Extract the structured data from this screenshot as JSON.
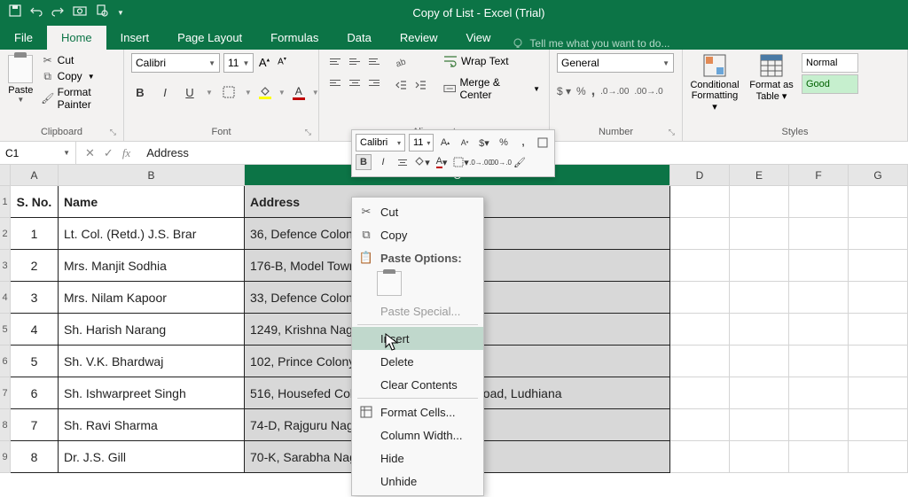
{
  "app": {
    "title": "Copy of List - Excel (Trial)"
  },
  "tabs": {
    "file": "File",
    "home": "Home",
    "insert": "Insert",
    "page_layout": "Page Layout",
    "formulas": "Formulas",
    "data": "Data",
    "review": "Review",
    "view": "View",
    "tellme": "Tell me what you want to do..."
  },
  "ribbon": {
    "clipboard": {
      "paste": "Paste",
      "cut": "Cut",
      "copy": "Copy",
      "format_painter": "Format Painter",
      "label": "Clipboard"
    },
    "font": {
      "name": "Calibri",
      "size": "11",
      "label": "Font"
    },
    "alignment": {
      "wrap": "Wrap Text",
      "merge": "Merge & Center",
      "label": "Alignment"
    },
    "number": {
      "format": "General",
      "label": "Number"
    },
    "styles": {
      "conditional": "Conditional Formatting",
      "format_as_table": "Format as Table",
      "normal": "Normal",
      "good": "Good",
      "label": "Styles"
    }
  },
  "namebox": "C1",
  "formula": "Address",
  "columns": {
    "A": "A",
    "B": "B",
    "C": "C",
    "D": "D",
    "E": "E",
    "F": "F",
    "G": "G"
  },
  "headers": {
    "sno": "S. No.",
    "name": "Name",
    "address": "Address"
  },
  "rows": [
    {
      "n": "1",
      "name": "Lt. Col. (Retd.) J.S. Brar",
      "addr": "36, Defence Colony, ...ana"
    },
    {
      "n": "2",
      "name": "Mrs. Manjit Sodhia",
      "addr": "176-B, Model Town, ..."
    },
    {
      "n": "3",
      "name": "Mrs. Nilam Kapoor",
      "addr": "33, Defence Colony, ...ana"
    },
    {
      "n": "4",
      "name": "Sh. Harish Narang",
      "addr": "1249, Krishna Nagar, ..."
    },
    {
      "n": "5",
      "name": "Sh. V.K. Bhardwaj",
      "addr": "102, Prince Colony, ... Kalan Ludhiana"
    },
    {
      "n": "6",
      "name": "Sh. Ishwarpreet Singh",
      "addr": "516, Housefed Colony, ...nue, Pakhowal Road, Ludhiana"
    },
    {
      "n": "7",
      "name": "Sh. Ravi Sharma",
      "addr": "74-D, Rajguru Nagar, ..."
    },
    {
      "n": "8",
      "name": "Dr. J.S. Gill",
      "addr": "70-K, Sarabha Nagar, ..."
    }
  ],
  "row_nums": [
    "1",
    "2",
    "3",
    "4",
    "5",
    "6",
    "7",
    "8",
    "9"
  ],
  "mini": {
    "font": "Calibri",
    "size": "11"
  },
  "menu": {
    "cut": "Cut",
    "copy": "Copy",
    "paste_options": "Paste Options:",
    "paste_special": "Paste Special...",
    "insert": "Insert",
    "delete": "Delete",
    "clear": "Clear Contents",
    "format_cells": "Format Cells...",
    "col_width": "Column Width...",
    "hide": "Hide",
    "unhide": "Unhide"
  }
}
